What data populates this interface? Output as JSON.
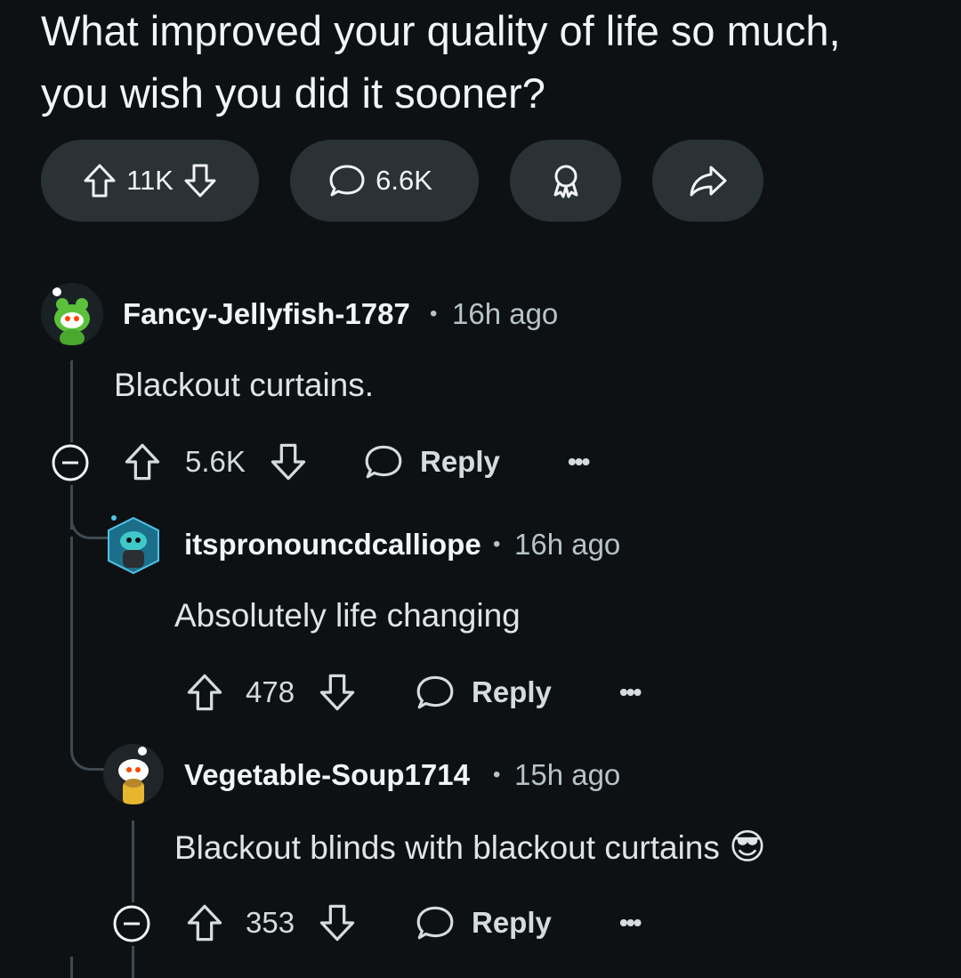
{
  "post": {
    "title": "What improved your quality of life so much, you wish you did it sooner?",
    "upvotes": "11K",
    "comments": "6.6K"
  },
  "comments": [
    {
      "username": "Fancy-Jellyfish-1787",
      "time": "16h ago",
      "body": "Blackout curtains.",
      "score": "5.6K",
      "reply_label": "Reply",
      "avatar_icon": "snoo-green-frog-avatar"
    },
    {
      "username": "itspronouncdcalliope",
      "time": "16h ago",
      "body": "Absolutely life changing",
      "score": "478",
      "reply_label": "Reply",
      "avatar_icon": "snoo-robot-avatar"
    },
    {
      "username": "Vegetable-Soup1714",
      "time": "15h ago",
      "body": "Blackout blinds with blackout curtains",
      "score": "353",
      "reply_label": "Reply",
      "avatar_icon": "snoo-yellow-avatar",
      "emoji": "😎"
    }
  ],
  "separator": "•",
  "more_label": "•••",
  "colors": {
    "background": "#0e1113",
    "pill": "#2a3236",
    "text": "#f2f4f5",
    "muted": "#b7c3c9",
    "thread": "#3e4a50"
  }
}
